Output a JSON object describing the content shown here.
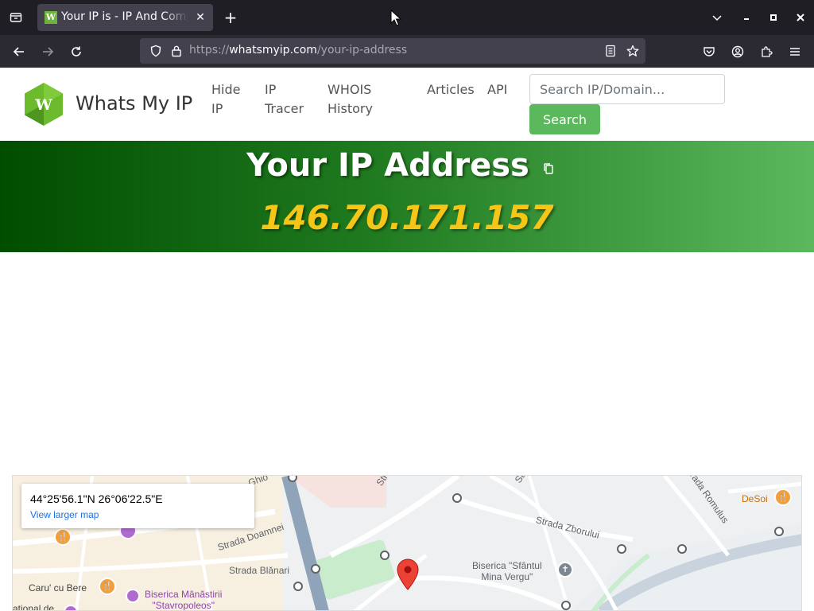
{
  "browser": {
    "tab": {
      "favicon_letter": "W",
      "title": "Your IP is - IP And Computer Information"
    },
    "url": {
      "scheme": "https://",
      "host": "whatsmyip.com",
      "path": "/your-ip-address"
    }
  },
  "site": {
    "logo_letter": "W",
    "brand": "Whats My IP",
    "nav": {
      "hide_ip": [
        "Hide",
        "IP"
      ],
      "ip_tracer": [
        "IP",
        "Tracer"
      ],
      "whois": [
        "WHOIS",
        "History"
      ],
      "articles": "Articles",
      "api": "API"
    },
    "search": {
      "placeholder": "Search IP/Domain...",
      "button": "Search"
    }
  },
  "hero": {
    "title": "Your IP Address",
    "ip": "146.70.171.157"
  },
  "map": {
    "coordinates": "44°25'56.1\"N 26°06'22.5\"E",
    "larger_map": "View larger map",
    "labels": {
      "strada_doamnei": "Strada Doamnei",
      "strada_blanari": "Strada Blănari",
      "strada_zborului": "Strada Zborului",
      "strada_romulus": "Strada Romulus",
      "biserica_mina_1": "Biserica \"Sfântul",
      "biserica_mina_2": "Mina Vergu\"",
      "caru_cu_bere": "Caru' cu Bere",
      "stavropoleos_1": "Biserica Mânăstirii",
      "stavropoleos_2": "\"Stavropoleos\"",
      "desoi": "DeSoi",
      "national_de": "ational de",
      "ghio": "Ghio",
      "str_top": "Str",
      "str_right": "St"
    }
  },
  "colors": {
    "accent_green": "#5cb85c",
    "ip_yellow": "#f5c518",
    "hero_dark": "#004d00"
  }
}
